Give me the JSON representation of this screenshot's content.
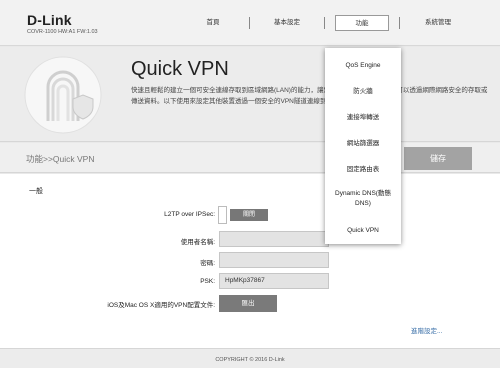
{
  "header": {
    "logo": "D-Link",
    "model": "COVR-1100 HW:A1 FW:1.03",
    "nav": [
      "首頁",
      "基本設定",
      "功能",
      "系統管理"
    ]
  },
  "hero": {
    "title": "Quick VPN",
    "description": "快速且輕鬆的建立一個可安全連線存取到區域網路(LAN)的能力，讓您的iOS及Mac OS X設備可以透過網際網路安全的存取或傳送資料。以下使用來設定其他裝置透過一個安全的VPN隧道連線到您的區域網路。"
  },
  "breadcrumb": "功能>>Quick VPN",
  "save_label": "儲存",
  "section": "一般",
  "form": {
    "l2tp_label": "L2TP over IPSec:",
    "l2tp_state": "關閉",
    "username_label": "使用者名稱:",
    "username_value": "",
    "password_label": "密碼:",
    "password_value": "",
    "psk_label": "PSK:",
    "psk_value": "HpMKp37867",
    "profile_label": "iOS及Mac OS X適用的VPN配置文件:",
    "export_label": "匯出"
  },
  "advanced_link": "進階設定...",
  "copyright": "COPYRIGHT © 2016 D-Link",
  "dropdown": [
    "QoS Engine",
    "防火牆",
    "連接埠轉送",
    "網站篩選器",
    "固定路由表",
    "Dynamic DNS(動態DNS)",
    "Quick VPN"
  ]
}
